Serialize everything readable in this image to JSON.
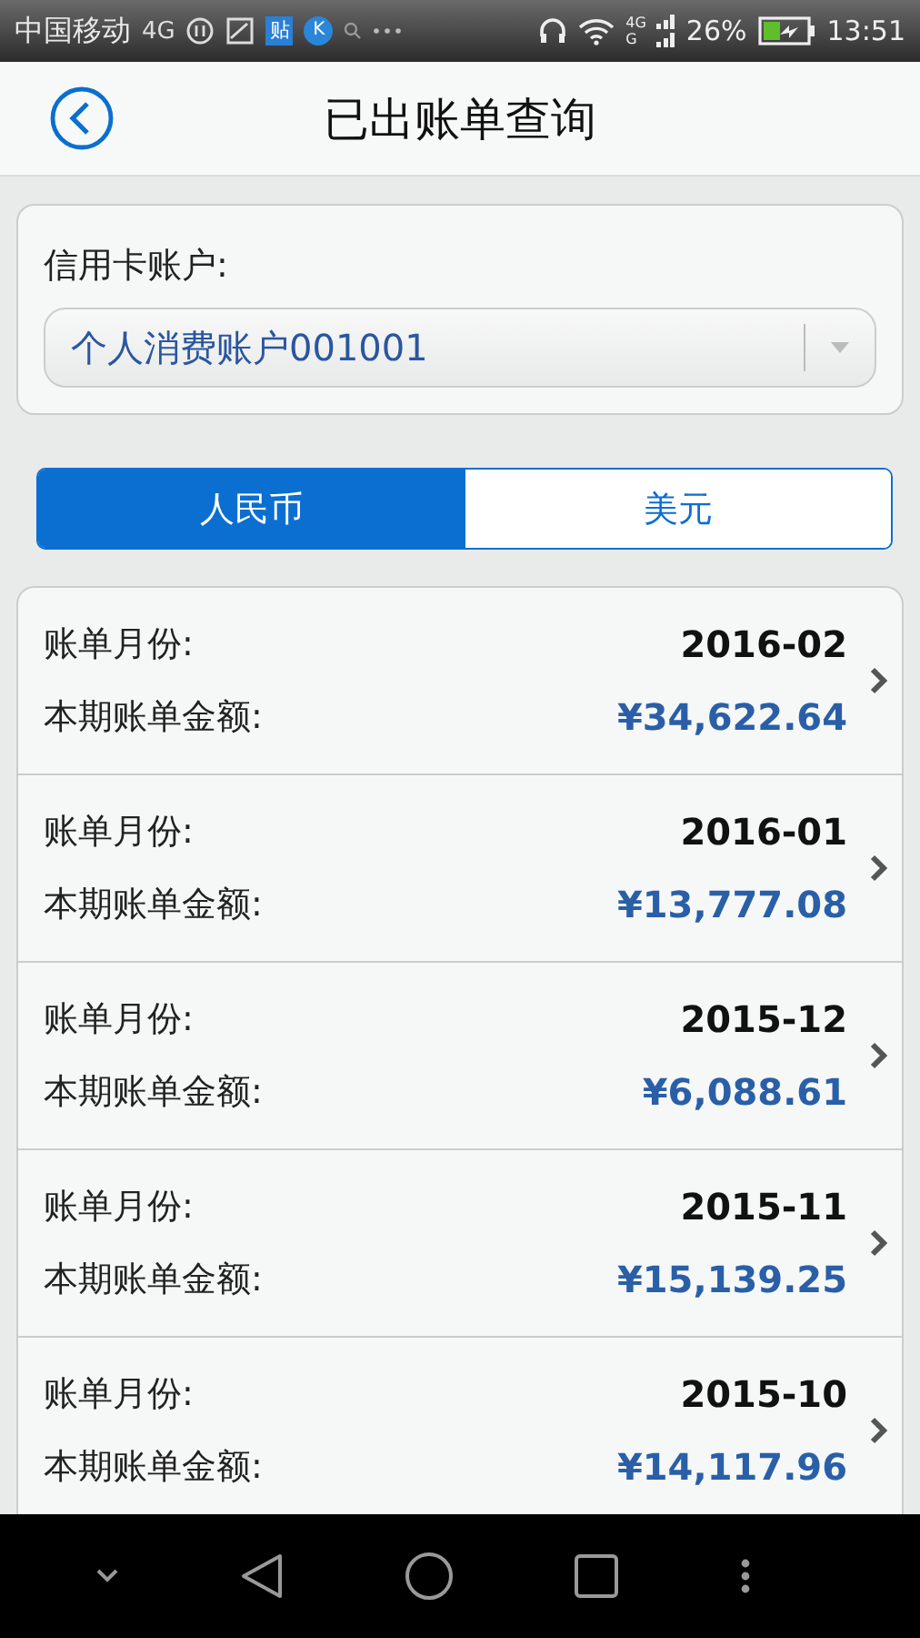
{
  "status_bar": {
    "carrier": "中国移动",
    "network": "4G",
    "app_badge": "贴",
    "k_badge": "K",
    "signal_top": "4G",
    "signal_bottom": "G",
    "battery": "26%",
    "time": "13:51"
  },
  "header": {
    "title": "已出账单查询"
  },
  "account": {
    "label": "信用卡账户:",
    "value": "个人消费账户001001"
  },
  "tabs": [
    {
      "label": "人民币",
      "selected": true
    },
    {
      "label": "美元",
      "selected": false
    }
  ],
  "bills": [
    {
      "month_label": "账单月份:",
      "month": "2016-02",
      "amount_label": "本期账单金额:",
      "amount": "¥34,622.64"
    },
    {
      "month_label": "账单月份:",
      "month": "2016-01",
      "amount_label": "本期账单金额:",
      "amount": "¥13,777.08"
    },
    {
      "month_label": "账单月份:",
      "month": "2015-12",
      "amount_label": "本期账单金额:",
      "amount": "¥6,088.61"
    },
    {
      "month_label": "账单月份:",
      "month": "2015-11",
      "amount_label": "本期账单金额:",
      "amount": "¥15,139.25"
    },
    {
      "month_label": "账单月份:",
      "month": "2015-10",
      "amount_label": "本期账单金额:",
      "amount": "¥14,117.96"
    }
  ]
}
